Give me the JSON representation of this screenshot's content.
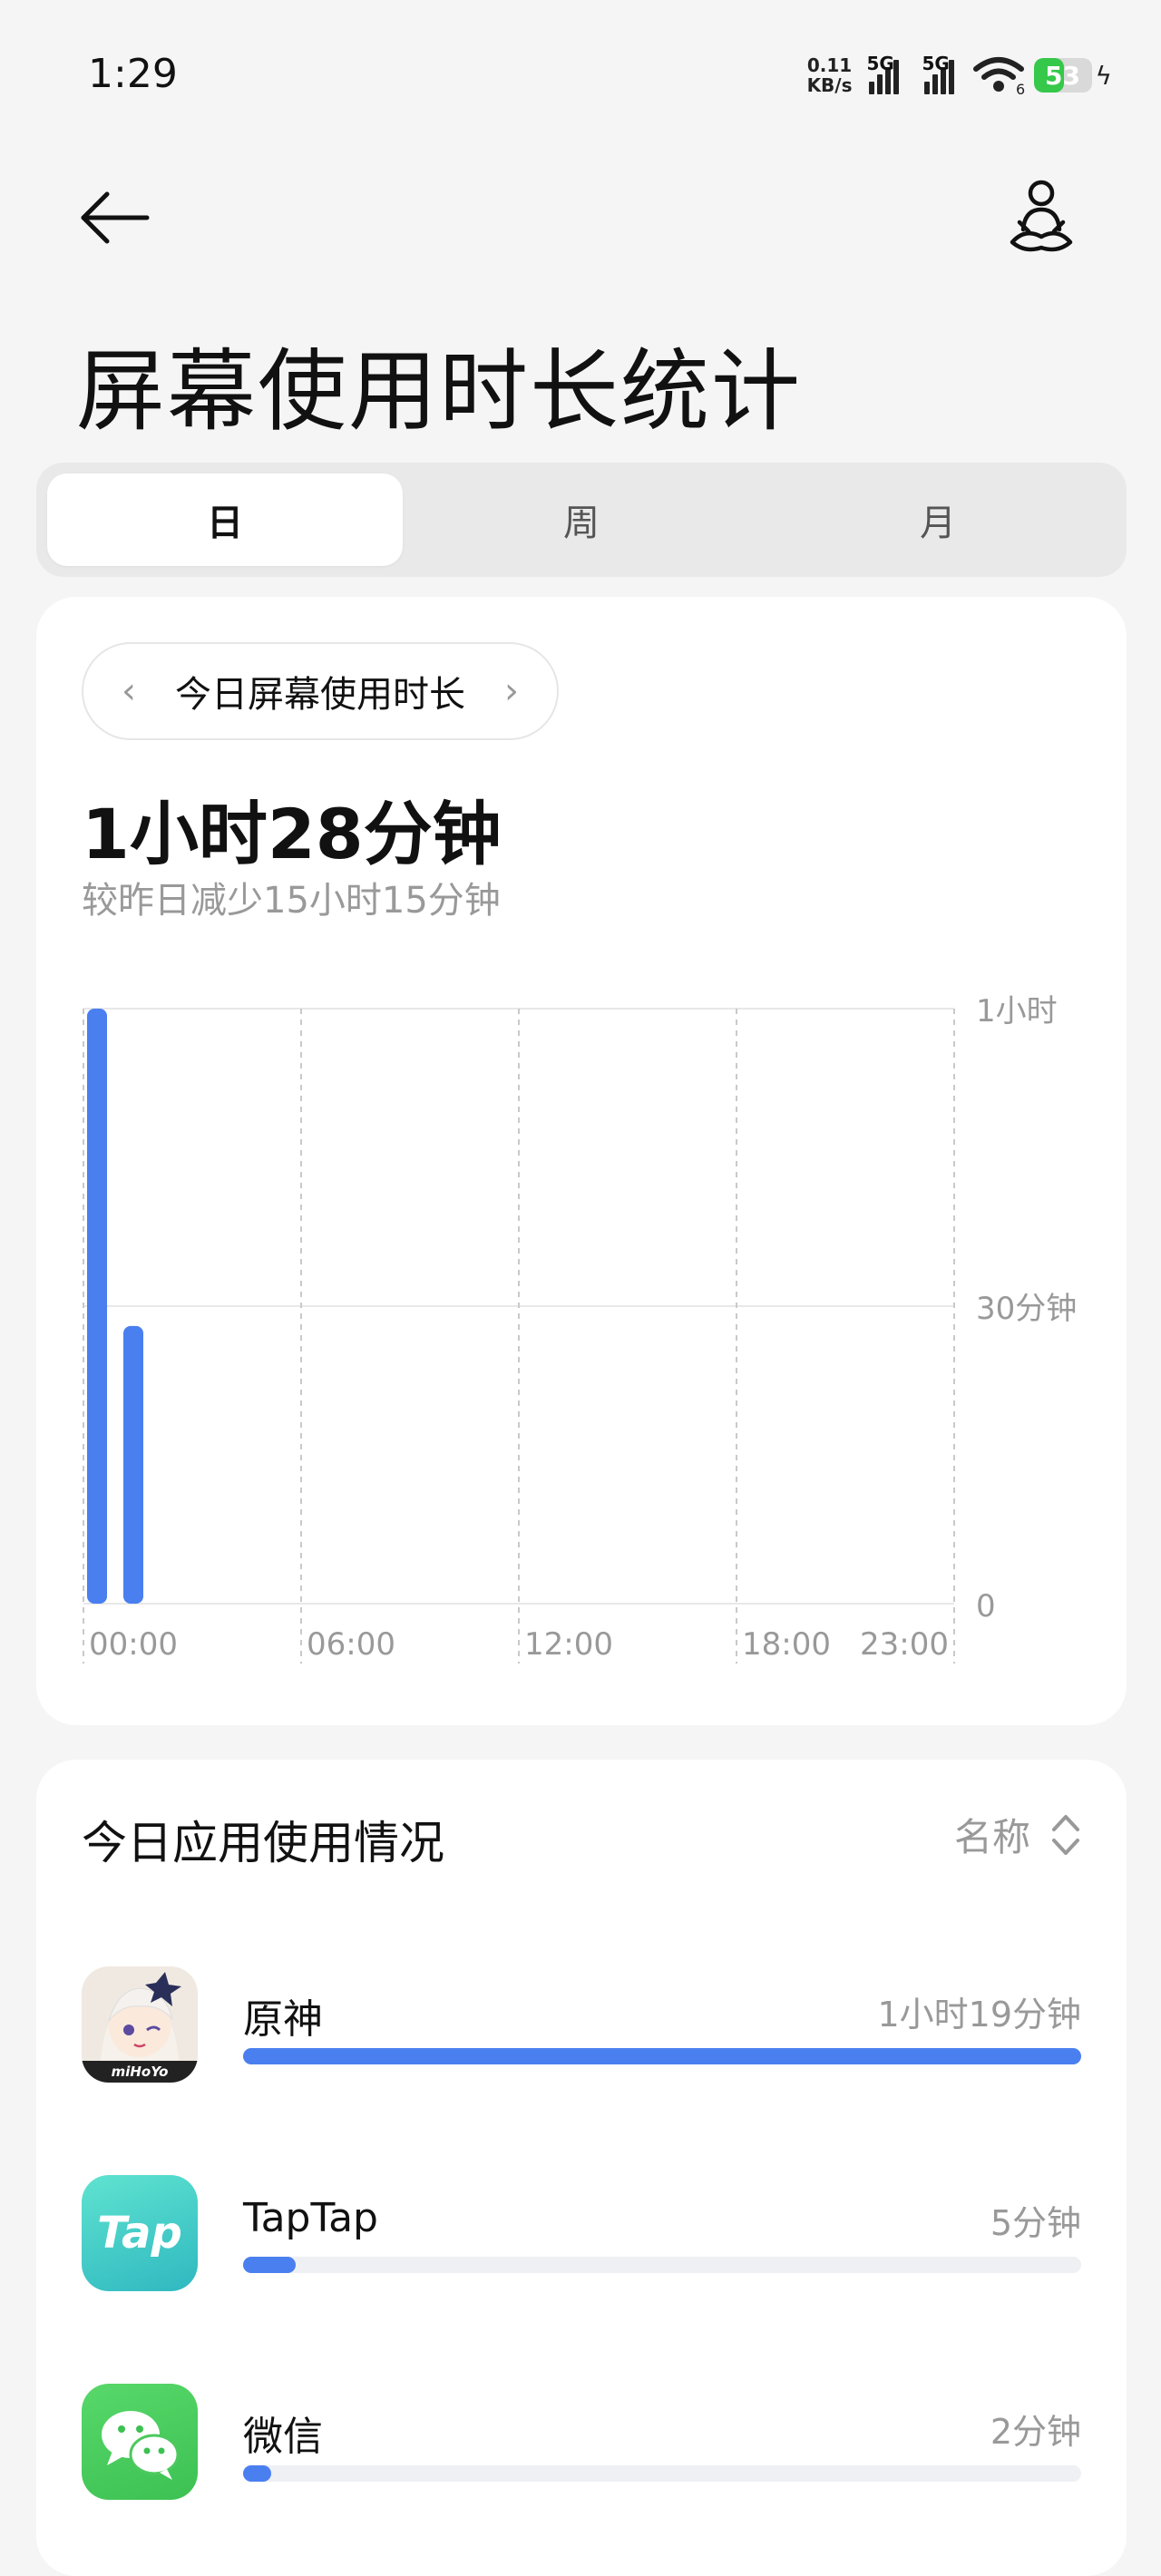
{
  "status_bar": {
    "time": "1:29",
    "net_speed_value": "0.11",
    "net_speed_unit": "KB/s",
    "sim1": "5G",
    "sim2": "5G",
    "wifi_label": "6",
    "battery": "53",
    "battery_level": 0.53
  },
  "header": {
    "title": "屏幕使用时长统计",
    "back_icon": "arrow-left-icon",
    "user_icon": "meditation-user-icon"
  },
  "tabs": [
    {
      "label": "日",
      "active": true
    },
    {
      "label": "周",
      "active": false
    },
    {
      "label": "月",
      "active": false
    }
  ],
  "summary": {
    "period_label": "今日屏幕使用时长",
    "total": "1小时28分钟",
    "compare": "较昨日减少15小时15分钟"
  },
  "chart_data": {
    "type": "bar",
    "x_tick_labels": [
      "00:00",
      "06:00",
      "12:00",
      "18:00",
      "23:00"
    ],
    "y_tick_labels": [
      "1小时",
      "30分钟",
      "0"
    ],
    "ylim_minutes": [
      0,
      60
    ],
    "hours": [
      0,
      1
    ],
    "values_minutes": [
      60,
      28
    ],
    "grid": true,
    "bar_color": "#4a7ff0"
  },
  "apps_section": {
    "title": "今日应用使用情况",
    "sort_label": "名称",
    "apps": [
      {
        "name": "原神",
        "duration": "1小时19分钟",
        "fraction": 1.0,
        "icon": "genshin-app-icon",
        "icon_text": "miHoYo"
      },
      {
        "name": "TapTap",
        "duration": "5分钟",
        "fraction": 0.063,
        "icon": "taptap-app-icon",
        "icon_text": "Tap"
      },
      {
        "name": "微信",
        "duration": "2分钟",
        "fraction": 0.034,
        "icon": "wechat-app-icon"
      }
    ]
  }
}
